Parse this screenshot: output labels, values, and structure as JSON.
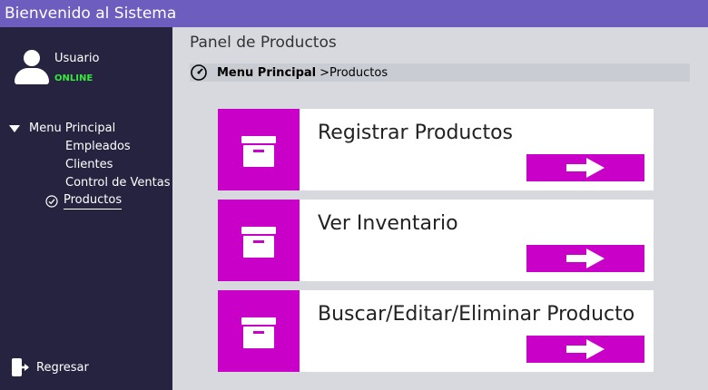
{
  "window": {
    "title": "Bienvenido al Sistema"
  },
  "sidebar": {
    "user": {
      "name": "Usuario",
      "status": "ONLINE"
    },
    "menu": {
      "root": "Menu Principal",
      "items": [
        "Empleados",
        "Clientes",
        "Control de Ventas"
      ],
      "active": "Productos"
    },
    "back_label": "Regresar"
  },
  "main": {
    "title": "Panel de Productos",
    "breadcrumb": {
      "root": "Menu Principal",
      "separator": ">",
      "current": "Productos"
    },
    "cards": [
      {
        "label": "Registrar Productos"
      },
      {
        "label": "Ver Inventario"
      },
      {
        "label": "Buscar/Editar/Eliminar Producto"
      }
    ]
  },
  "colors": {
    "accent": "#c800c8",
    "titlebar": "#6d5dbe",
    "sidebar": "#262341",
    "status": "#37e83a"
  }
}
